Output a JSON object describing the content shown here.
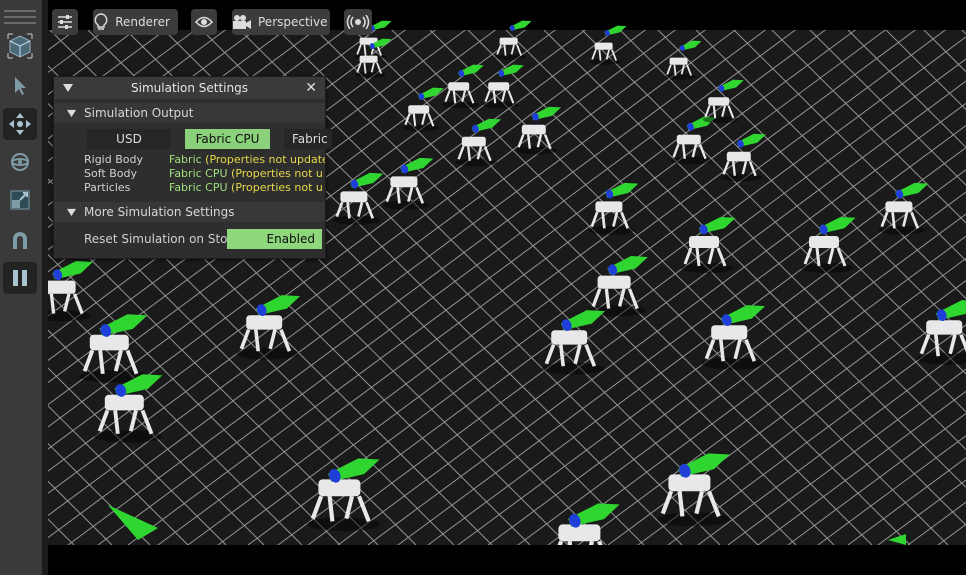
{
  "toolbar": {
    "renderer_label": "Renderer",
    "camera_label": "Perspective",
    "icons": [
      "settings-sliders-icon",
      "lightbulb-icon",
      "eye-icon",
      "camera-icon",
      "broadcast-icon"
    ]
  },
  "tools": [
    "grip-icon",
    "cube-icon",
    "select-arrow-icon",
    "move-icon",
    "rotate-icon",
    "scale-icon",
    "snap-magnet-icon",
    "pause-icon"
  ],
  "panel": {
    "title": "Simulation Settings",
    "section1": {
      "title": "Simulation Output",
      "tabs": [
        "USD",
        "Fabric CPU",
        "Fabric"
      ],
      "selected_tab": "Fabric CPU",
      "rows": [
        {
          "label": "Rigid Body",
          "value": "Fabric",
          "warning": "(Properties not update"
        },
        {
          "label": "Soft Body",
          "value": "Fabric CPU",
          "warning": "(Properties not u"
        },
        {
          "label": "Particles",
          "value": "Fabric CPU",
          "warning": "(Properties not u"
        }
      ]
    },
    "section2": {
      "title": "More Simulation Settings",
      "reset_label": "Reset Simulation on Stop",
      "reset_value": "Enabled"
    }
  },
  "colors": {
    "accent_green": "#8bd07a",
    "warning_yellow": "#e6d84a",
    "grid": "#cfcfcf",
    "arrow_green": "#2fd62f",
    "arrow_blue": "#1f3fd8"
  }
}
